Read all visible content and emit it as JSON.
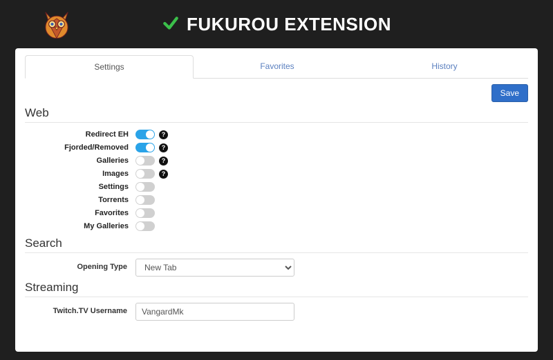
{
  "header": {
    "title": "FUKUROU EXTENSION"
  },
  "tabs": [
    {
      "label": "Settings",
      "active": true
    },
    {
      "label": "Favorites",
      "active": false
    },
    {
      "label": "History",
      "active": false
    }
  ],
  "toolbar": {
    "save_label": "Save"
  },
  "sections": {
    "web": {
      "title": "Web",
      "rows": [
        {
          "label": "Redirect EH",
          "on": true,
          "help": true
        },
        {
          "label": "Fjorded/Removed",
          "on": true,
          "help": true
        },
        {
          "label": "Galleries",
          "on": false,
          "help": true
        },
        {
          "label": "Images",
          "on": false,
          "help": true
        },
        {
          "label": "Settings",
          "on": false,
          "help": false
        },
        {
          "label": "Torrents",
          "on": false,
          "help": false
        },
        {
          "label": "Favorites",
          "on": false,
          "help": false
        },
        {
          "label": "My Galleries",
          "on": false,
          "help": false
        }
      ]
    },
    "search": {
      "title": "Search",
      "opening_type_label": "Opening Type",
      "opening_type_value": "New Tab"
    },
    "streaming": {
      "title": "Streaming",
      "twitch_label": "Twitch.TV Username",
      "twitch_value": "VangardMk"
    }
  },
  "help_glyph": "?"
}
